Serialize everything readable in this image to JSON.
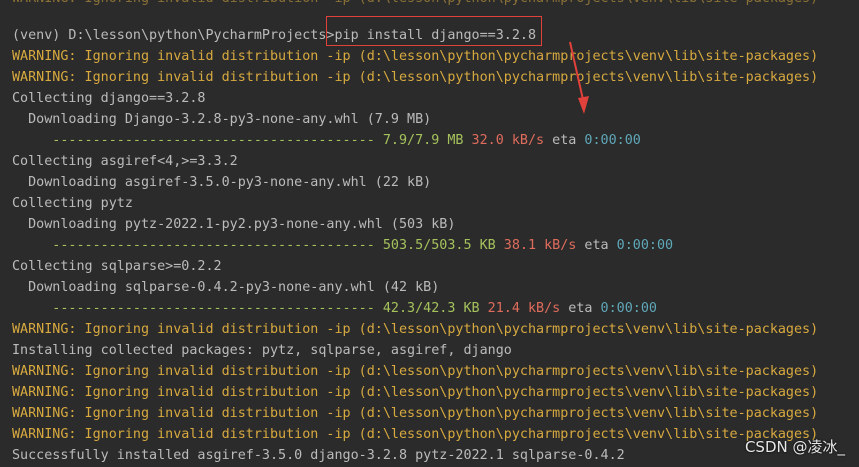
{
  "terminal": {
    "top_fragment": "WARNING: Ignoring invalid distribution -ip (d:\\lesson\\python\\pycharmprojects\\venv\\lib\\site-packages)",
    "prompt": "(venv) D:\\lesson\\python\\PycharmProjects>",
    "command": "pip install django==3.2.8",
    "warning_text": "WARNING: Ignoring invalid distribution -ip (d:\\lesson\\python\\pycharmprojects\\venv\\lib\\site-packages)",
    "collect_django": "Collecting django==3.2.8",
    "download_django": "  Downloading Django-3.2.8-py3-none-any.whl (7.9 MB)",
    "bar": "     ----------------------------------------",
    "progress_django": {
      "size": "7.9/7.9 MB",
      "rate": "32.0 kB/s",
      "eta_label": "eta",
      "eta": "0:00:00"
    },
    "collect_asgiref": "Collecting asgiref<4,>=3.3.2",
    "download_asgiref": "  Downloading asgiref-3.5.0-py3-none-any.whl (22 kB)",
    "collect_pytz": "Collecting pytz",
    "download_pytz": "  Downloading pytz-2022.1-py2.py3-none-any.whl (503 kB)",
    "progress_pytz": {
      "size": "503.5/503.5 KB",
      "rate": "38.1 kB/s",
      "eta_label": "eta",
      "eta": "0:00:00"
    },
    "collect_sqlparse": "Collecting sqlparse>=0.2.2",
    "download_sqlparse": "  Downloading sqlparse-0.4.2-py3-none-any.whl (42 kB)",
    "progress_sqlparse": {
      "size": "42.3/42.3 KB",
      "rate": "21.4 kB/s",
      "eta_label": "eta",
      "eta": "0:00:00"
    },
    "installing": "Installing collected packages: pytz, sqlparse, asgiref, django",
    "success": "Successfully installed asgiref-3.5.0 django-3.2.8 pytz-2022.1 sqlparse-0.4.2"
  },
  "watermark": "CSDN @凌冰_",
  "colors": {
    "background": "#2b2b2b",
    "text": "#bbbbbb",
    "warning": "#d7a93f",
    "progress": "#a5c25c",
    "rate": "#e06c5c",
    "eta": "#5fa8b8",
    "annotation": "#e0413a"
  }
}
